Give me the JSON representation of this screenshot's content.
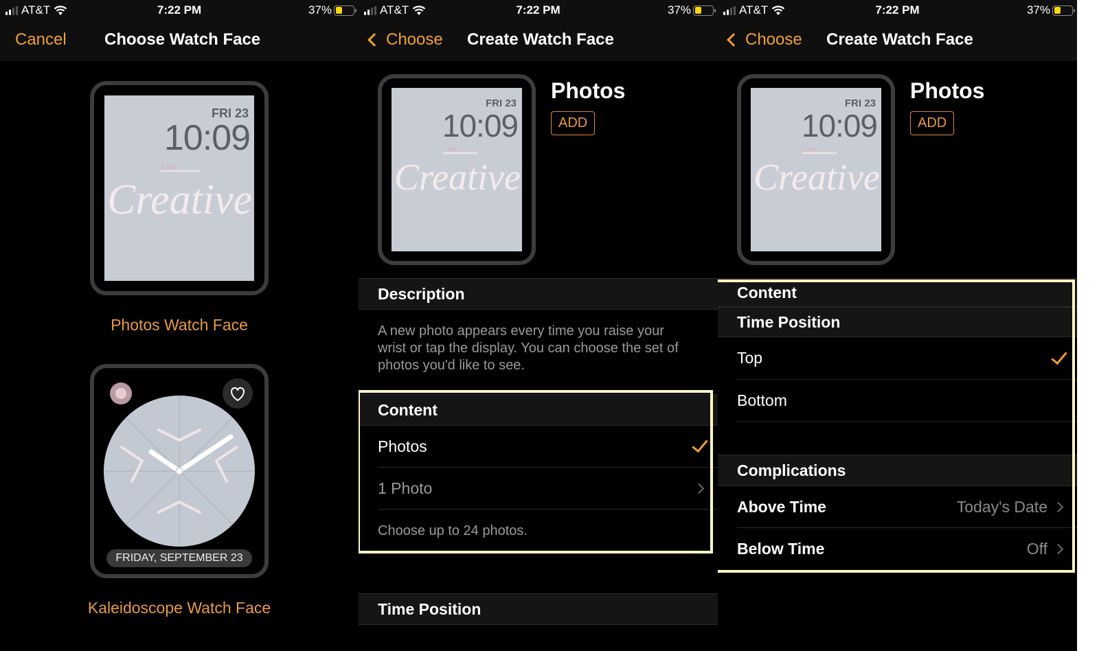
{
  "status_bar": {
    "carrier": "AT&T",
    "time": "7:22 PM",
    "battery_percent": "37%",
    "battery_level": 0.37,
    "battery_color": "#ffd60a"
  },
  "accent_color": "#f0a030",
  "panel1": {
    "nav": {
      "left_button": "Cancel",
      "title": "Choose Watch Face"
    },
    "faces": [
      {
        "name": "Photos Watch Face",
        "preview": {
          "date": "FRI 23",
          "time": "10:09",
          "overlay_small": "I AM",
          "overlay_script": "Creative"
        }
      },
      {
        "name": "Kaleidoscope Watch Face",
        "preview": {
          "date_banner": "FRIDAY, SEPTEMBER 23",
          "top_left_complication": "breathe-flower-icon",
          "top_right_complication": "heart-icon"
        }
      }
    ]
  },
  "panel2": {
    "nav": {
      "back_label": "Choose",
      "title": "Create Watch Face"
    },
    "preview": {
      "date": "FRI 23",
      "time": "10:09",
      "overlay_small": "I AM",
      "overlay_script": "Creative"
    },
    "face_title": "Photos",
    "add_button": "ADD",
    "description_header": "Description",
    "description_text": "A new photo appears every time you raise your wrist or tap the display. You can choose the set of photos you'd like to see.",
    "content_header": "Content",
    "content_rows": [
      {
        "label": "Photos",
        "selected": true
      },
      {
        "label": "1 Photo",
        "disclosure": true
      }
    ],
    "content_footnote": "Choose up to 24 photos.",
    "time_position_header": "Time Position"
  },
  "panel3": {
    "nav": {
      "back_label": "Choose",
      "title": "Create Watch Face"
    },
    "preview": {
      "date": "FRI 23",
      "time": "10:09",
      "overlay_small": "I AM",
      "overlay_script": "Creative"
    },
    "face_title": "Photos",
    "add_button": "ADD",
    "content_header": "Content",
    "time_position_header": "Time Position",
    "time_position_rows": [
      {
        "label": "Top",
        "selected": true
      },
      {
        "label": "Bottom",
        "selected": false
      }
    ],
    "complications_header": "Complications",
    "complication_rows": [
      {
        "label": "Above Time",
        "value": "Today's Date"
      },
      {
        "label": "Below Time",
        "value": "Off"
      }
    ]
  }
}
